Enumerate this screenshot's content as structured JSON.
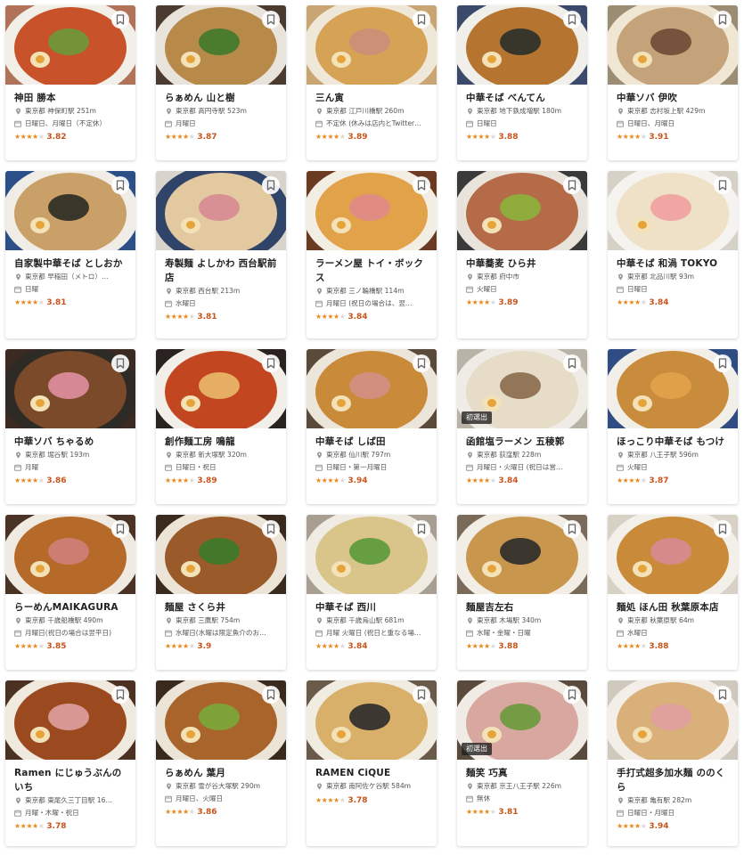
{
  "accent_color": "#c9541b",
  "star_color": "#e58a1f",
  "icons": {
    "bookmark": "bookmark-icon",
    "location": "location-pin-icon",
    "closed_days": "calendar-icon",
    "star": "star-icon"
  },
  "cards": [
    {
      "name": "神田 勝本",
      "location": "東京都 神保町駅 251m",
      "closed": "日曜日、月曜日（不定休）",
      "stars": 4,
      "rating": "3.82",
      "badge": "",
      "photo": {
        "bg": "#b0735a",
        "soup": "#c8532a",
        "bowl": "#f2efe9",
        "top": "#6a9a3a"
      }
    },
    {
      "name": "らぁめん 山と樹",
      "location": "東京都 高円寺駅 523m",
      "closed": "月曜日",
      "stars": 4,
      "rating": "3.87",
      "badge": "",
      "photo": {
        "bg": "#4a3a30",
        "soup": "#b88a4a",
        "bowl": "#e9e4db",
        "top": "#3f7a2a"
      }
    },
    {
      "name": "三ん寅",
      "location": "東京都 江戸川橋駅 260m",
      "closed": "不定休 (休みは店内とTwitter…",
      "stars": 4,
      "rating": "3.89",
      "badge": "",
      "photo": {
        "bg": "#c9a574",
        "soup": "#d6a356",
        "bowl": "#efe8d8",
        "top": "#c98f7a"
      }
    },
    {
      "name": "中華そば べんてん",
      "location": "東京都 地下鉄成増駅 180m",
      "closed": "日曜日",
      "stars": 4,
      "rating": "3.88",
      "badge": "",
      "photo": {
        "bg": "#3b4a6a",
        "soup": "#b5742f",
        "bowl": "#f1efe9",
        "top": "#2a2f2a"
      }
    },
    {
      "name": "中華ソバ 伊吹",
      "location": "東京都 志村坂上駅 429m",
      "closed": "日曜日、月曜日",
      "stars": 4,
      "rating": "3.91",
      "badge": "",
      "photo": {
        "bg": "#9b8c74",
        "soup": "#c5a37a",
        "bowl": "#efe6d4",
        "top": "#6b4a36"
      }
    },
    {
      "name": "自家製中華そば としおか",
      "location": "東京都 早稲田（メトロ）…",
      "closed": "日曜",
      "stars": 4,
      "rating": "3.81",
      "badge": "",
      "photo": {
        "bg": "#2b4f86",
        "soup": "#c9a067",
        "bowl": "#f0ede6",
        "top": "#2a2a22"
      }
    },
    {
      "name": "寿製麺 よしかわ 西台駅前店",
      "location": "東京都 西台駅 213m",
      "closed": "水曜日",
      "stars": 4,
      "rating": "3.81",
      "badge": "",
      "photo": {
        "bg": "#d8d4cc",
        "soup": "#e2c9a0",
        "bowl": "#2f4468",
        "top": "#d88a94"
      }
    },
    {
      "name": "ラーメン屋 トイ・ボックス",
      "location": "東京都 三ノ輪橋駅 114m",
      "closed": "月曜日 (祝日の場合は、翌…",
      "stars": 4,
      "rating": "3.84",
      "badge": "",
      "photo": {
        "bg": "#6a3a22",
        "soup": "#e2a24a",
        "bowl": "#f3eee4",
        "top": "#e08a8a"
      }
    },
    {
      "name": "中華蕎麦 ひら井",
      "location": "東京都 府中市",
      "closed": "火曜日",
      "stars": 4,
      "rating": "3.89",
      "badge": "",
      "photo": {
        "bg": "#3a3a3a",
        "soup": "#b56a48",
        "bowl": "#e8e4dc",
        "top": "#8ab23a"
      }
    },
    {
      "name": "中華そば 和渦 TOKYO",
      "location": "東京都 北品川駅 93m",
      "closed": "日曜日",
      "stars": 4,
      "rating": "3.84",
      "badge": "",
      "photo": {
        "bg": "#d6d1c7",
        "soup": "#efe0c8",
        "bowl": "#f5f3ef",
        "top": "#f0a1a0"
      }
    },
    {
      "name": "中華ソバ ちゃるめ",
      "location": "東京都 堀谷駅 193m",
      "closed": "月曜",
      "stars": 4,
      "rating": "3.86",
      "badge": "",
      "photo": {
        "bg": "#3a2a22",
        "soup": "#7a4a2a",
        "bowl": "#2e2a26",
        "top": "#e08fa0"
      }
    },
    {
      "name": "創作麺工房 鳴龍",
      "location": "東京都 新大塚駅 320m",
      "closed": "日曜日・祝日",
      "stars": 4,
      "rating": "3.89",
      "badge": "",
      "photo": {
        "bg": "#2a2220",
        "soup": "#c2461f",
        "bowl": "#f2eee8",
        "top": "#e9b96a"
      }
    },
    {
      "name": "中華そば しば田",
      "location": "東京都 仙川駅 797m",
      "closed": "日曜日・第一月曜日",
      "stars": 4,
      "rating": "3.94",
      "badge": "",
      "photo": {
        "bg": "#5a4a3a",
        "soup": "#c98a3a",
        "bowl": "#ece6da",
        "top": "#d38f86"
      }
    },
    {
      "name": "函館塩ラーメン 五稜郭",
      "location": "東京都 荻窪駅 228m",
      "closed": "月曜日・火曜日 (祝日は営…",
      "stars": 4,
      "rating": "3.84",
      "badge": "初選出",
      "photo": {
        "bg": "#b9b2a6",
        "soup": "#e6dcc8",
        "bowl": "#efece6",
        "top": "#8a6a4a"
      }
    },
    {
      "name": "ほっこり中華そば もつけ",
      "location": "東京都 八王子駅 596m",
      "closed": "火曜日",
      "stars": 4,
      "rating": "3.87",
      "badge": "",
      "photo": {
        "bg": "#2f4d83",
        "soup": "#c98b3c",
        "bowl": "#f2efe9",
        "top": "#e2a24a"
      }
    },
    {
      "name": "らーめんMAIKAGURA",
      "location": "東京都 千歳船橋駅 490m",
      "closed": "月曜日(祝日の場合は翌平日)",
      "stars": 4,
      "rating": "3.85",
      "badge": "",
      "photo": {
        "bg": "#4a3324",
        "soup": "#b56a2a",
        "bowl": "#f0ebe2",
        "top": "#d0807a"
      }
    },
    {
      "name": "麺屋 さくら井",
      "location": "東京都 三鷹駅 754m",
      "closed": "水曜日(水曜は限定魚介のお…",
      "stars": 4,
      "rating": "3.9",
      "badge": "",
      "photo": {
        "bg": "#3a2a1e",
        "soup": "#9a5a2a",
        "bowl": "#ece4d6",
        "top": "#3a7a2a"
      }
    },
    {
      "name": "中華そば 西川",
      "location": "東京都 千歳烏山駅 681m",
      "closed": "月曜 火曜日 (祝日と重なる場…",
      "stars": 4,
      "rating": "3.84",
      "badge": "",
      "photo": {
        "bg": "#a89f92",
        "soup": "#d9c48a",
        "bowl": "#f0ece4",
        "top": "#5a9a3a"
      }
    },
    {
      "name": "麺屋吉左右",
      "location": "東京都 木場駅 340m",
      "closed": "水曜・金曜・日曜",
      "stars": 4,
      "rating": "3.88",
      "badge": "",
      "photo": {
        "bg": "#7a6a5a",
        "soup": "#c9964e",
        "bowl": "#f2eee6",
        "top": "#2a2a2a"
      }
    },
    {
      "name": "麺処 ほん田 秋葉原本店",
      "location": "東京都 秋葉原駅 64m",
      "closed": "水曜日",
      "stars": 4,
      "rating": "3.88",
      "badge": "",
      "photo": {
        "bg": "#d8d2c6",
        "soup": "#c98a3a",
        "bowl": "#f3f0ea",
        "top": "#d88a94"
      }
    },
    {
      "name": "Ramen にじゅうぶんのいち",
      "location": "東京都 東尾久三丁目駅 16…",
      "closed": "月曜・木曜・祝日",
      "stars": 4,
      "rating": "3.78",
      "badge": "",
      "photo": {
        "bg": "#4a3122",
        "soup": "#9a4a1e",
        "bowl": "#efe9de",
        "top": "#e0a0a0"
      }
    },
    {
      "name": "らぁめん 葉月",
      "location": "東京都 雪が谷大塚駅 290m",
      "closed": "月曜日、火曜日",
      "stars": 4,
      "rating": "3.86",
      "badge": "",
      "photo": {
        "bg": "#3a2a1e",
        "soup": "#a8642a",
        "bowl": "#ece4d6",
        "top": "#7aa83a"
      }
    },
    {
      "name": "RAMEN CiQUE",
      "location": "東京都 南阿佐ケ谷駅 584m",
      "closed": "",
      "stars": 4,
      "rating": "3.78",
      "badge": "",
      "photo": {
        "bg": "#6a5a4a",
        "soup": "#d9b06a",
        "bowl": "#f1ece2",
        "top": "#2a2a2a"
      }
    },
    {
      "name": "麺笑 巧真",
      "location": "東京都 京王八王子駅 226m",
      "closed": "無休",
      "stars": 4,
      "rating": "3.81",
      "badge": "初選出",
      "photo": {
        "bg": "#5a4a3e",
        "soup": "#d8a8a0",
        "bowl": "#f0ebe4",
        "top": "#6a9a3a"
      }
    },
    {
      "name": "手打式超多加水麺 ののくら",
      "location": "東京都 亀有駅 282m",
      "closed": "日曜日・月曜日",
      "stars": 4,
      "rating": "3.94",
      "badge": "",
      "photo": {
        "bg": "#cfc8bc",
        "soup": "#d9b07a",
        "bowl": "#f3efe8",
        "top": "#e0a0a0"
      }
    }
  ]
}
